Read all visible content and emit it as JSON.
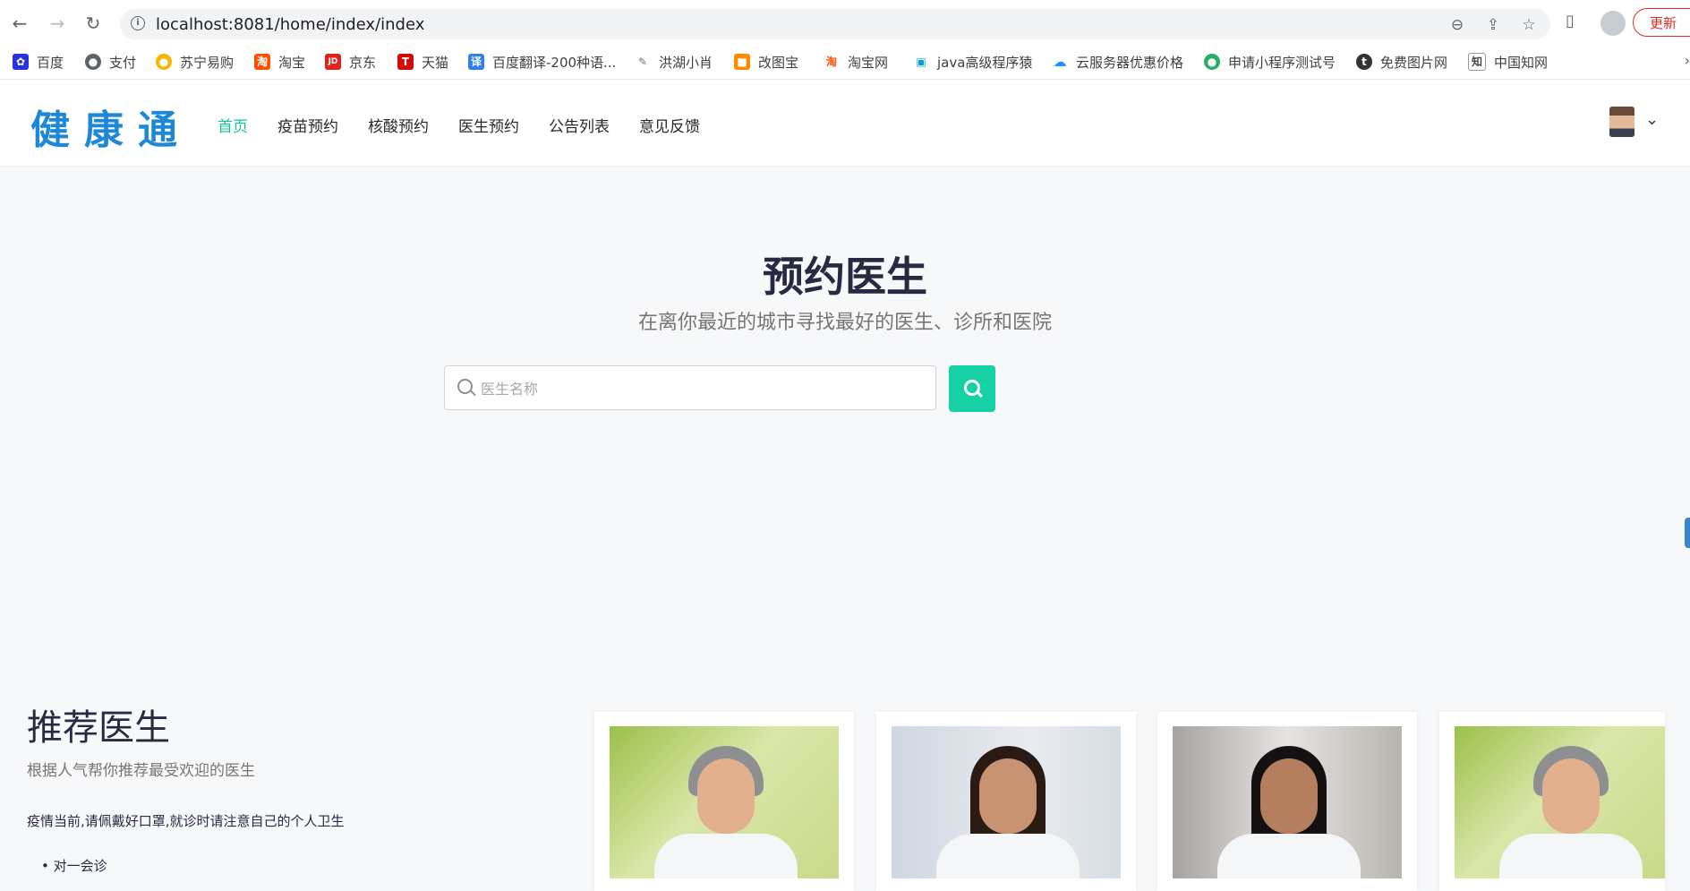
{
  "browser": {
    "url": "localhost:8081/home/index/index",
    "update_label": "更新",
    "bookmarks": [
      {
        "label": "百度",
        "color": "#2932e1",
        "glyph": "✿"
      },
      {
        "label": "支付",
        "color": "#5f6368",
        "glyph": "●"
      },
      {
        "label": "苏宁易购",
        "color": "#f5b800",
        "glyph": "●"
      },
      {
        "label": "淘宝",
        "color": "#ff5000",
        "glyph": "淘"
      },
      {
        "label": "京东",
        "color": "#e1251b",
        "glyph": "JD"
      },
      {
        "label": "天猫",
        "color": "#d70a0a",
        "glyph": "T"
      },
      {
        "label": "百度翻译-200种语...",
        "color": "#2f7ff0",
        "glyph": "译"
      },
      {
        "label": "洪湖小肖",
        "color": "#777777",
        "glyph": "✎"
      },
      {
        "label": "改图宝",
        "color": "#ff8a00",
        "glyph": "■"
      },
      {
        "label": "淘宝网",
        "color": "#ff5000",
        "glyph": "淘"
      },
      {
        "label": "java高级程序猿",
        "color": "#00a1d6",
        "glyph": "▣"
      },
      {
        "label": "云服务器优惠价格",
        "color": "#1e90ff",
        "glyph": "☁"
      },
      {
        "label": "申请小程序测试号",
        "color": "#2aae67",
        "glyph": "●"
      },
      {
        "label": "免费图片网",
        "color": "#333333",
        "glyph": "t"
      },
      {
        "label": "中国知网",
        "color": "#444444",
        "glyph": "知"
      }
    ]
  },
  "site": {
    "logo": "健康通",
    "nav": [
      "首页",
      "疫苗预约",
      "核酸预约",
      "医生预约",
      "公告列表",
      "意见反馈"
    ],
    "active_nav": "首页",
    "accent_color": "#15c39a"
  },
  "banner": {
    "title": "预约医生",
    "subtitle": "在离你最近的城市寻找最好的医生、诊所和医院",
    "search_placeholder": "医生名称"
  },
  "recommended": {
    "title": "推荐医生",
    "subtitle": "根据人气帮你推荐最受欢迎的医生",
    "notice": "疫情当前,请佩戴好口罩,就诊时请注意自己的个人卫生",
    "list_item": "• 对一会诊"
  }
}
